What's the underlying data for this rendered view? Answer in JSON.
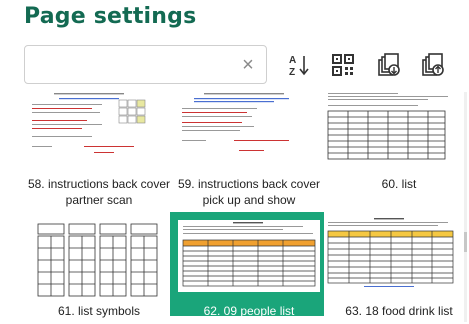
{
  "page": {
    "title": "Page settings"
  },
  "search": {
    "value": "",
    "placeholder": "",
    "clear_glyph": "×"
  },
  "toolbar": {
    "sort_icon": "sort-az-icon",
    "qr_icon": "qr-code-icon",
    "import_icon": "import-pages-icon",
    "export_icon": "export-pages-icon"
  },
  "pages": [
    {
      "label": "58. instructions back cover partner scan",
      "kind": "doc-color"
    },
    {
      "label": "59. instructions back cover pick up and show",
      "kind": "doc-color"
    },
    {
      "label": "60. list",
      "kind": "table"
    },
    {
      "label": "61. list symbols",
      "kind": "boxes"
    },
    {
      "label": "62. 09 people list",
      "kind": "orange-table",
      "selected": true
    },
    {
      "label": "63. 18 food drink list",
      "kind": "yellow-table"
    }
  ],
  "colors": {
    "title": "#136a52",
    "selected": "#1aa57a"
  }
}
